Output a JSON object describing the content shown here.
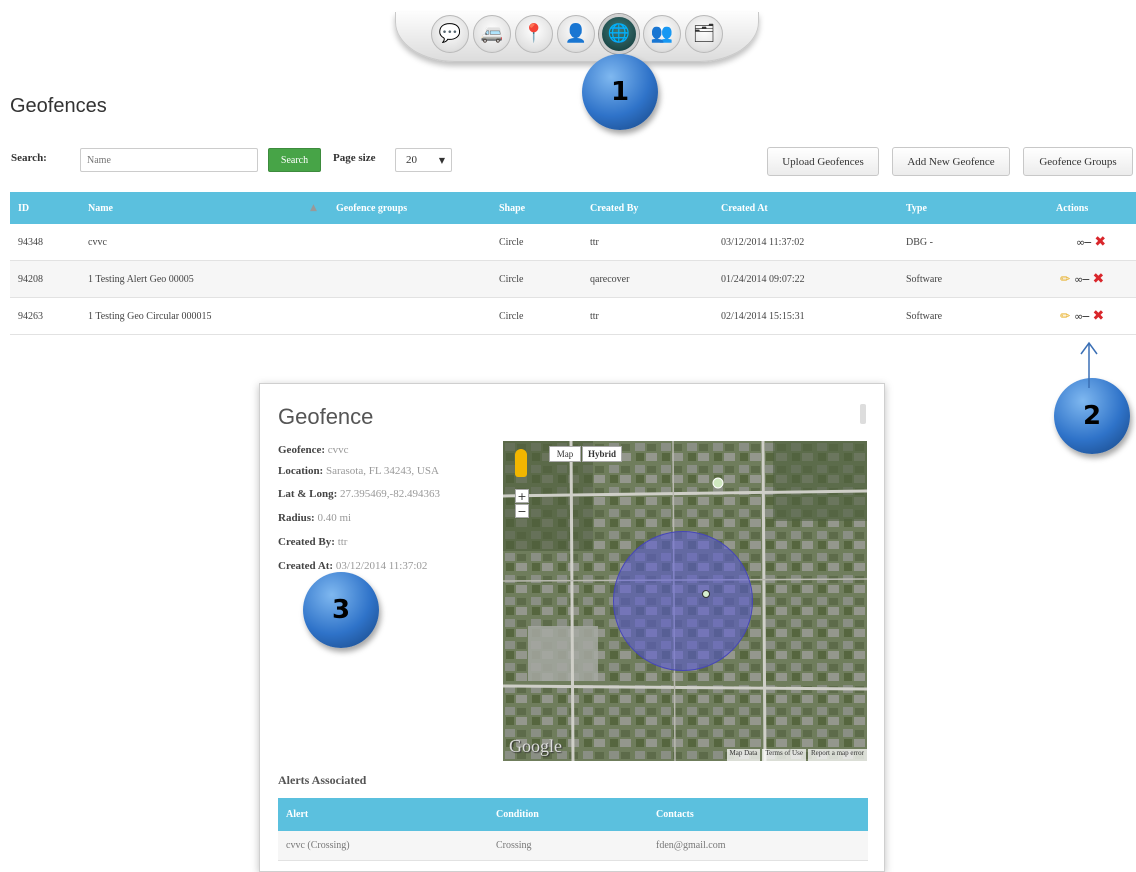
{
  "toolbar": {
    "buttons": [
      {
        "icon": "chat-bubble-icon",
        "glyph": "💬"
      },
      {
        "icon": "van-icon",
        "glyph": "🚐"
      },
      {
        "icon": "map-marker-icon",
        "glyph": "📍"
      },
      {
        "icon": "user-icon",
        "glyph": "👤"
      },
      {
        "icon": "globe-icon",
        "glyph": "🌐"
      },
      {
        "icon": "group-icon",
        "glyph": "👥"
      },
      {
        "icon": "report-icon",
        "glyph": "🗂"
      }
    ]
  },
  "badges": {
    "one": "1",
    "two": "2",
    "three": "3"
  },
  "page": {
    "title": "Geofences"
  },
  "search": {
    "label": "Search:",
    "placeholder": "Name",
    "button": "Search",
    "page_size_label": "Page size",
    "page_size_value": "20"
  },
  "actions": {
    "upload": "Upload Geofences",
    "add": "Add New Geofence",
    "groups": "Geofence Groups"
  },
  "table": {
    "headers": {
      "id": "ID",
      "name": "Name",
      "groups": "Geofence groups",
      "shape": "Shape",
      "created_by": "Created By",
      "created_at": "Created At",
      "type": "Type",
      "actions": "Actions"
    },
    "rows": [
      {
        "id": "94348",
        "name": "cvvc",
        "groups": "",
        "shape": "Circle",
        "created_by": "ttr",
        "created_at": "03/12/2014 11:37:02",
        "type": "DBG -"
      },
      {
        "id": "94208",
        "name": "1 Testing Alert Geo 00005",
        "groups": "",
        "shape": "Circle",
        "created_by": "qarecover",
        "created_at": "01/24/2014 09:07:22",
        "type": "Software"
      },
      {
        "id": "94263",
        "name": "1 Testing Geo Circular 000015",
        "groups": "",
        "shape": "Circle",
        "created_by": "ttr",
        "created_at": "02/14/2014 15:15:31",
        "type": "Software"
      }
    ]
  },
  "modal": {
    "title": "Geofence",
    "details": [
      {
        "label": "Geofence:",
        "value": " cvvc"
      },
      {
        "label": "Location:",
        "value": " Sarasota, FL 34243, USA"
      },
      {
        "label": "Lat & Long:",
        "value": " 27.395469,-82.494363"
      },
      {
        "label": "Radius:",
        "value": " 0.40 mi"
      },
      {
        "label": "Created By:",
        "value": " ttr"
      },
      {
        "label": "Created At:",
        "value": " 03/12/2014 11:37:02"
      }
    ],
    "map": {
      "map_button": "Map",
      "hybrid_button": "Hybrid",
      "zoom_in": "+",
      "zoom_out": "−",
      "logo": "Google",
      "footer": [
        "Map Data",
        "Terms of Use",
        "Report a map error"
      ]
    },
    "alerts": {
      "title": "Alerts Associated",
      "headers": {
        "alert": "Alert",
        "condition": "Condition",
        "contacts": "Contacts"
      },
      "rows": [
        {
          "alert": "cvvc (Crossing)",
          "condition": "Crossing",
          "contacts": "fden@gmail.com"
        }
      ]
    }
  },
  "colors": {
    "header_blue": "#5bc0de",
    "search_green": "#47a447",
    "badge_blue": "#2f73c9",
    "delete_red": "#d9262b",
    "geofence_fill": "#5a5adc"
  }
}
